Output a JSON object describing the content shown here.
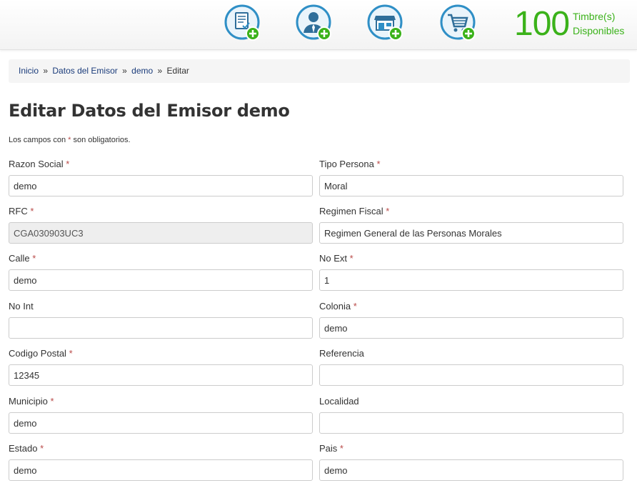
{
  "header": {
    "icons": [
      {
        "name": "invoice-add-icon"
      },
      {
        "name": "client-add-icon"
      },
      {
        "name": "store-add-icon"
      },
      {
        "name": "cart-add-icon"
      }
    ],
    "credits": {
      "count": "100",
      "label_line1": "Timbre(s)",
      "label_line2": "Disponibles"
    }
  },
  "breadcrumb": {
    "items": [
      "Inicio",
      "Datos del Emisor",
      "demo"
    ],
    "separator": "»",
    "current": "Editar"
  },
  "page": {
    "title": "Editar Datos del Emisor demo",
    "required_note_before": "Los campos con ",
    "required_mark": "*",
    "required_note_after": " son obligatorios."
  },
  "form": {
    "razon_social": {
      "label": "Razon Social",
      "value": "demo",
      "required": true
    },
    "tipo_persona": {
      "label": "Tipo Persona",
      "value": "Moral",
      "required": true
    },
    "rfc": {
      "label": "RFC",
      "value": "CGA030903UC3",
      "required": true,
      "readonly": true
    },
    "regimen_fiscal": {
      "label": "Regimen Fiscal",
      "value": "Regimen General de las Personas Morales",
      "required": true
    },
    "calle": {
      "label": "Calle",
      "value": "demo",
      "required": true
    },
    "no_ext": {
      "label": "No Ext",
      "value": "1",
      "required": true
    },
    "no_int": {
      "label": "No Int",
      "value": "",
      "required": false
    },
    "colonia": {
      "label": "Colonia",
      "value": "demo",
      "required": true
    },
    "codigo_postal": {
      "label": "Codigo Postal",
      "value": "12345",
      "required": true
    },
    "referencia": {
      "label": "Referencia",
      "value": "",
      "required": false
    },
    "municipio": {
      "label": "Municipio",
      "value": "demo",
      "required": true
    },
    "localidad": {
      "label": "Localidad",
      "value": "",
      "required": false
    },
    "estado": {
      "label": "Estado",
      "value": "demo",
      "required": true
    },
    "pais": {
      "label": "Pais",
      "value": "demo",
      "required": true
    }
  },
  "colors": {
    "accent_green": "#3bb21a",
    "icon_blue": "#2f8fc6",
    "link": "#1a3b7a",
    "required": "#b94a48"
  }
}
